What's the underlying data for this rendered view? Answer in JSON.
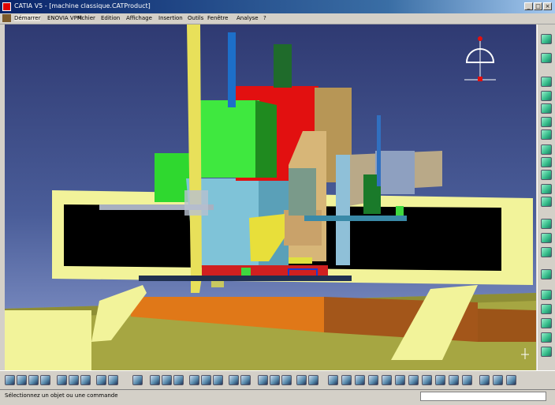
{
  "window": {
    "title": "CATIA V5 - [machine classique.CATProduct]"
  },
  "menu": {
    "items": [
      "Démarrer",
      "ENOVIA VPM",
      "Fichier",
      "Edition",
      "Affichage",
      "Insertion",
      "Outils",
      "Fenêtre",
      "Analyse",
      "?"
    ],
    "active_index": 0
  },
  "status": {
    "message": "Sélectionnez un objet ou une commande",
    "command_placeholder": ""
  },
  "compass": {
    "icon": "compass-icon"
  },
  "colors": {
    "viewport_top": "#2f3a72",
    "viewport_bottom": "#8d9ed0",
    "frame_yellow": "#f2f39a",
    "olive_base": "#a6a642",
    "orange_plate": "#e07818"
  }
}
